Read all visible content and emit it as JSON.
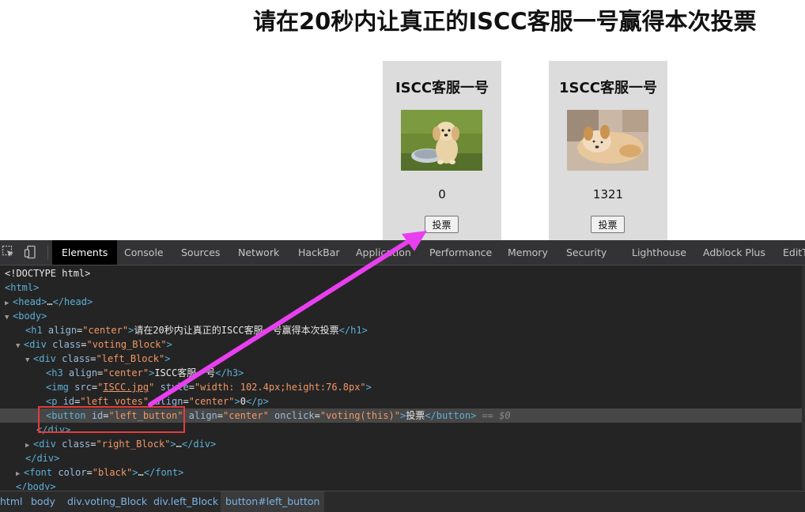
{
  "page": {
    "title": "请在20秒内让真正的ISCC客服一号赢得本次投票",
    "left_block": {
      "title": "ISCC客服一号",
      "votes": "0",
      "button": "投票"
    },
    "right_block": {
      "title": "1SCC客服一号",
      "votes": "1321",
      "button": "投票"
    }
  },
  "devtools": {
    "tabs": [
      "Elements",
      "Console",
      "Sources",
      "Network",
      "HackBar",
      "Application",
      "Performance",
      "Memory",
      "Security",
      "Lighthouse",
      "Adblock Plus",
      "EditT"
    ],
    "active_tab": "Elements",
    "code": {
      "doctype": "<!DOCTYPE html>",
      "html": "<html>",
      "head_open": "<head>",
      "ellipsis": "…",
      "head_close": "</head>",
      "body_open": "<body>",
      "h1_open": "<h1",
      "align_attr": "align",
      "center_val": "\"center\"",
      "gt": ">",
      "h1_text": "请在20秒内让真正的ISCC客服一号赢得本次投票",
      "h1_close": "</h1>",
      "div_open": "<div",
      "class_attr": "class",
      "voting_block_val": "\"voting_Block\"",
      "left_block_val": "\"left_Block\"",
      "h3_open": "<h3",
      "h3_text": "ISCC客服一号",
      "h3_close": "</h3>",
      "img_open": "<img",
      "src_attr": "src",
      "img_src": "ISCC.jpg",
      "style_attr": "style",
      "style_val": "\"width: 102.4px;height:76.8px\"",
      "p_open": "<p",
      "id_attr": "id",
      "p_id_val": "\"left_votes\"",
      "p_text": "0",
      "p_close": "</p>",
      "button_open": "<button",
      "button_id_val": "\"left_button\"",
      "onclick_attr": "onclick",
      "onclick_val": "\"voting(this)\"",
      "button_text": "投票",
      "button_close": "</button>",
      "selected_marker": "== $0",
      "div_close": "</div>",
      "right_block_val": "\"right_Block\"",
      "font_open": "<font",
      "color_attr": "color",
      "color_val": "\"black\"",
      "font_close": "</font>",
      "body_close": "</body>",
      "equals": "=",
      "quote": "\""
    },
    "breadcrumbs": [
      "html",
      "body",
      "div.voting_Block",
      "div.left_Block",
      "button#left_button"
    ]
  },
  "colors": {
    "annotation_box": "#e23c3c",
    "annotation_arrow": "#e83ff0",
    "block_bg": "#dcdcdc",
    "devtools_bg": "#242424"
  }
}
